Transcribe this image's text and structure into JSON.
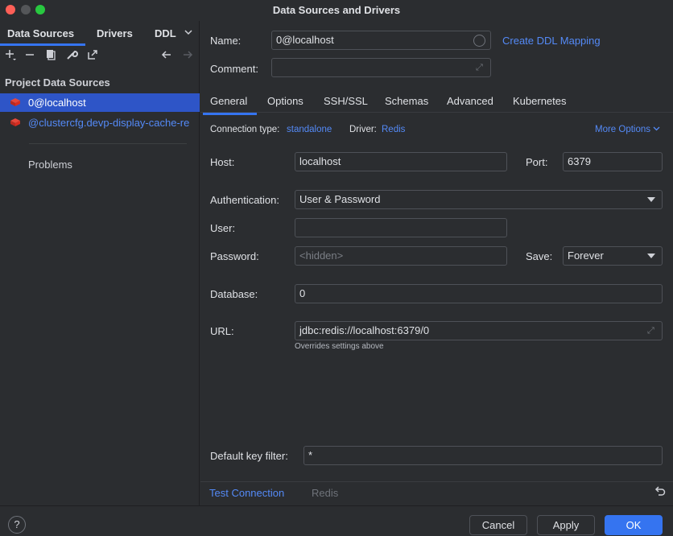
{
  "window": {
    "title": "Data Sources and Drivers"
  },
  "sidebar": {
    "tabs": [
      "Data Sources",
      "Drivers",
      "DDL"
    ],
    "section_title": "Project Data Sources",
    "items": [
      {
        "label": "0@localhost"
      },
      {
        "label": "@clustercfg.devp-display-cache-re"
      }
    ],
    "problems_label": "Problems"
  },
  "form": {
    "name_label": "Name:",
    "name_value": "0@localhost",
    "create_ddl_label": "Create DDL Mapping",
    "comment_label": "Comment:",
    "comment_value": ""
  },
  "tabs": [
    "General",
    "Options",
    "SSH/SSL",
    "Schemas",
    "Advanced",
    "Kubernetes"
  ],
  "general": {
    "connection_type_label": "Connection type:",
    "connection_type_value": "standalone",
    "driver_label": "Driver:",
    "driver_value": "Redis",
    "more_options_label": "More Options",
    "host_label": "Host:",
    "host_value": "localhost",
    "port_label": "Port:",
    "port_value": "6379",
    "auth_label": "Authentication:",
    "auth_value": "User & Password",
    "user_label": "User:",
    "user_value": "",
    "password_label": "Password:",
    "password_placeholder": "<hidden>",
    "save_label": "Save:",
    "save_value": "Forever",
    "database_label": "Database:",
    "database_value": "0",
    "url_label": "URL:",
    "url_value": "jdbc:redis://localhost:6379/0",
    "url_hint": "Overrides settings above",
    "default_key_filter_label": "Default key filter:",
    "default_key_filter_value": "*"
  },
  "bottom": {
    "test_connection_label": "Test Connection",
    "redis_label": "Redis"
  },
  "footer": {
    "help_label": "?",
    "cancel_label": "Cancel",
    "apply_label": "Apply",
    "ok_label": "OK"
  },
  "colors": {
    "accent": "#3574f0",
    "selection": "#2e55c7",
    "link": "#548af7",
    "redis_red": "#d82c20"
  }
}
